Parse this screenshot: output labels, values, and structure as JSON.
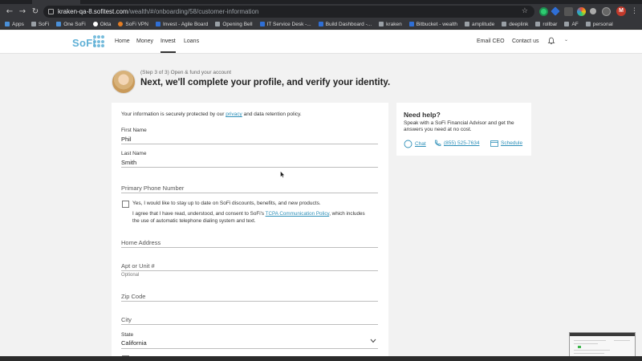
{
  "browser": {
    "url_host": "kraken-qa-8.sofitest.com",
    "url_path": "/wealth/#/onboarding/58/customer-information",
    "profile_initial": "M",
    "bookmarks": [
      "Apps",
      "SoFi",
      "One SoFi",
      "Okta",
      "SoFi VPN",
      "Invest - Agile Board",
      "Opening Bell",
      "IT Service Desk -...",
      "Build Dashboard -...",
      "kraken",
      "Bitbucket - wealth",
      "amplitude",
      "deeplink",
      "rollbar",
      "AF",
      "personal"
    ]
  },
  "site": {
    "logo_text": "SoFi",
    "nav": [
      "Home",
      "Money",
      "Invest",
      "Loans"
    ],
    "active_nav": "Invest",
    "email_ceo": "Email CEO",
    "contact_us": "Contact us",
    "brand_color": "#5fb0d6",
    "link_color": "#2d8fb8"
  },
  "onboarding": {
    "step_label": "(Step 3 of 3) Open & fund your account",
    "title": "Next, we'll complete your profile, and verify your identity."
  },
  "form": {
    "secure_prefix": "Your information is securely protected by our ",
    "privacy_link": "privacy",
    "secure_suffix": " and data retention policy.",
    "first_name_label": "First Name",
    "first_name_value": "Phil",
    "last_name_label": "Last Name",
    "last_name_value": "Smith",
    "phone_placeholder": "Primary Phone Number",
    "opt_in_text": "Yes, I would like to stay up to date on SoFi discounts, benefits, and new products.",
    "consent_prefix": "I agree that I have read, understood, and consent to SoFi's ",
    "consent_link": "TCPA Communication Policy",
    "consent_suffix": ", which includes the use of automatic telephone dialing system and text.",
    "home_address_placeholder": "Home Address",
    "apt_placeholder": "Apt or Unit #",
    "apt_hint": "Optional",
    "zip_placeholder": "Zip Code",
    "city_placeholder": "City",
    "state_label": "State",
    "state_value": "California"
  },
  "help": {
    "title": "Need help?",
    "body": "Speak with a SoFi Financial Advisor and get the answers you need at no cost.",
    "chat_label": "Chat",
    "phone_label": "(855) 525-7634",
    "schedule_label": "Schedule"
  }
}
